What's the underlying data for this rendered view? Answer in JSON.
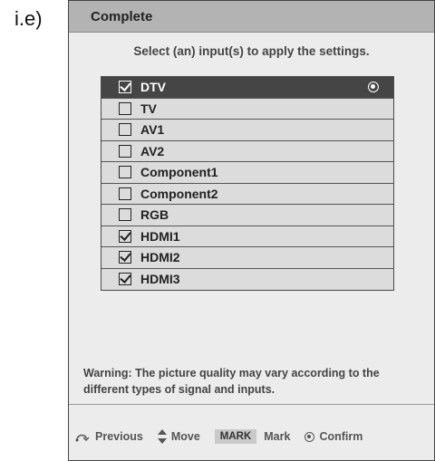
{
  "step_label": "i.e)",
  "dialog": {
    "title": "Complete",
    "instruction": "Select (an) input(s) to apply the settings.",
    "inputs": [
      {
        "label": "DTV",
        "checked": true,
        "selected": true
      },
      {
        "label": "TV",
        "checked": false,
        "selected": false
      },
      {
        "label": "AV1",
        "checked": false,
        "selected": false
      },
      {
        "label": "AV2",
        "checked": false,
        "selected": false
      },
      {
        "label": "Component1",
        "checked": false,
        "selected": false
      },
      {
        "label": "Component2",
        "checked": false,
        "selected": false
      },
      {
        "label": "RGB",
        "checked": false,
        "selected": false
      },
      {
        "label": "HDMI1",
        "checked": true,
        "selected": false
      },
      {
        "label": "HDMI2",
        "checked": true,
        "selected": false
      },
      {
        "label": "HDMI3",
        "checked": true,
        "selected": false
      }
    ],
    "warning": "Warning: The picture quality  may vary according to the different types of signal and inputs.",
    "footer": {
      "previous": "Previous",
      "move": "Move",
      "mark_key": "MARK",
      "mark": "Mark",
      "confirm": "Confirm"
    }
  },
  "colors": {
    "header_bg": "#b3b3b3",
    "selected_row": "#454545",
    "row_bg": "#dcdcdc",
    "dialog_bg": "#ececec"
  }
}
